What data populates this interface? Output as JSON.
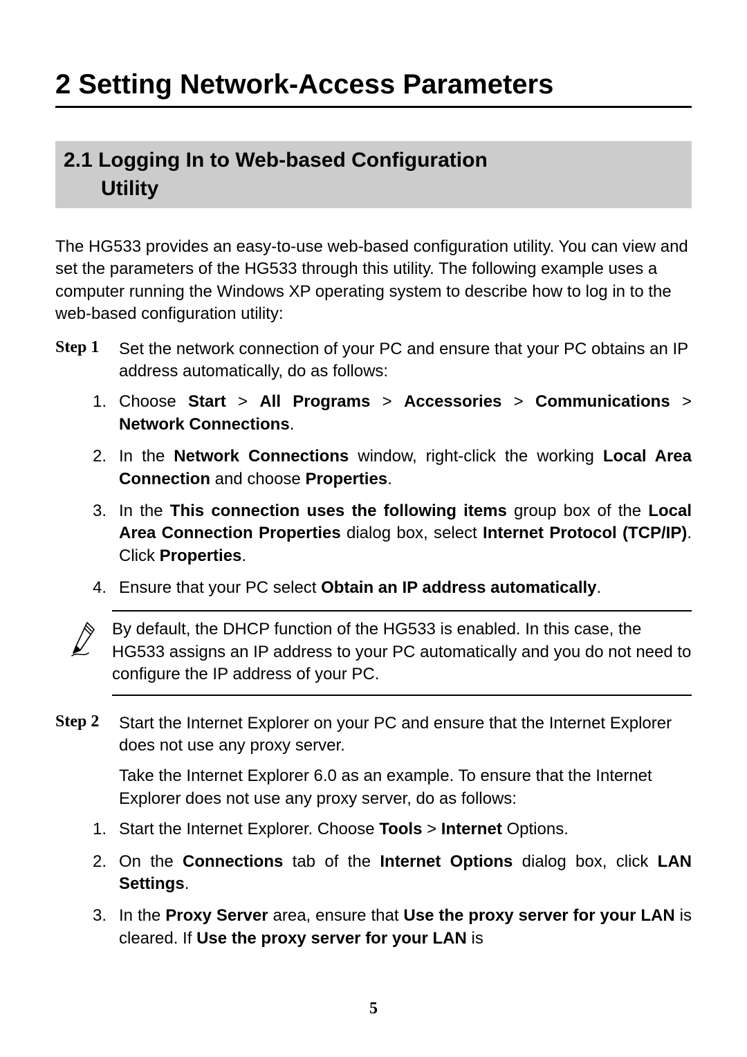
{
  "chapter": {
    "number": "2",
    "title": "Setting Network-Access Parameters"
  },
  "section": {
    "number": "2.1",
    "title_line1": "Logging In to Web-based Configuration",
    "title_line2": "Utility"
  },
  "intro": "The HG533 provides an easy-to-use web-based configuration utility. You can view and set the parameters of the HG533 through this utility. The following example uses a computer running the Windows XP operating system to describe how to log in to the web-based configuration utility:",
  "step1": {
    "label": "Step 1",
    "text": "Set the network connection of your PC and ensure that your PC obtains an IP address automatically, do as follows:",
    "sub": [
      {
        "n": "1.",
        "parts": [
          "Choose ",
          "Start",
          " > ",
          "All Programs",
          " > ",
          "Accessories",
          " > ",
          "Communications",
          " > ",
          "Network Connections",
          "."
        ]
      },
      {
        "n": "2.",
        "parts": [
          "In the ",
          "Network Connections",
          " window, right-click the working ",
          "Local Area Connection",
          " and choose ",
          "Properties",
          "."
        ]
      },
      {
        "n": "3.",
        "parts": [
          "In the ",
          "This connection uses the following items",
          " group box of the ",
          "Local Area Connection Properties",
          " dialog box, select ",
          "Internet Protocol (TCP/IP)",
          ". Click ",
          "Properties",
          "."
        ]
      },
      {
        "n": "4.",
        "parts": [
          "Ensure that your PC select ",
          "Obtain an IP address automatically",
          "."
        ]
      }
    ]
  },
  "note": "By default, the DHCP function of the HG533 is enabled. In this case, the HG533 assigns an IP address to your PC automatically and you do not need to configure the IP address of your PC.",
  "step2": {
    "label": "Step 2",
    "text1": "Start the Internet Explorer on your PC and ensure that the Internet Explorer does not use any proxy server.",
    "text2": "Take the Internet Explorer 6.0 as an example. To ensure that the Internet Explorer does not use any proxy server, do as follows:",
    "sub": [
      {
        "n": "1.",
        "parts": [
          "Start the Internet Explorer. Choose ",
          "Tools",
          " > ",
          "Internet",
          " Options."
        ]
      },
      {
        "n": "2.",
        "parts": [
          "On the ",
          "Connections",
          " tab of the ",
          "Internet Options",
          " dialog box, click ",
          "LAN Settings",
          "."
        ]
      },
      {
        "n": "3.",
        "parts": [
          "In the ",
          "Proxy Server",
          " area, ensure that ",
          "Use the proxy server for your LAN",
          " is cleared. If ",
          "Use the proxy server for your LAN",
          " is"
        ]
      }
    ]
  },
  "page_number": "5"
}
